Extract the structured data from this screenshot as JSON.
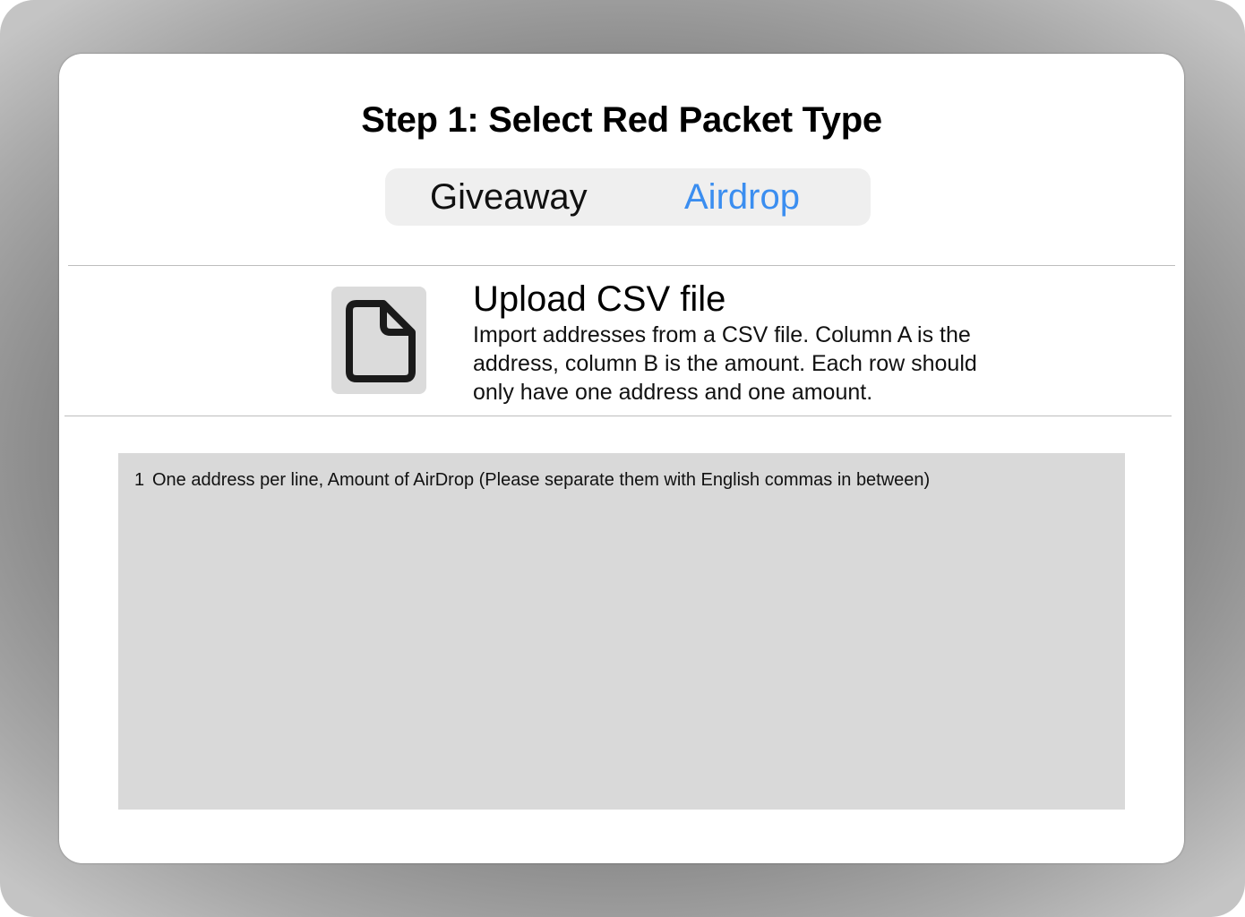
{
  "dialog": {
    "title": "Step 1: Select Red Packet Type"
  },
  "packet_type": {
    "options": [
      {
        "label": "Giveaway",
        "selected": false
      },
      {
        "label": "Airdrop",
        "selected": true
      }
    ],
    "selected_color": "#3b8ef0"
  },
  "upload": {
    "icon": "file-icon",
    "title": "Upload CSV file",
    "description": "Import addresses from a CSV file. Column A is the address, column B is the amount. Each row should only have one address and one amount."
  },
  "address_input": {
    "line_number": "1",
    "placeholder": "One address per line, Amount of AirDrop (Please separate them with English commas in between)"
  }
}
